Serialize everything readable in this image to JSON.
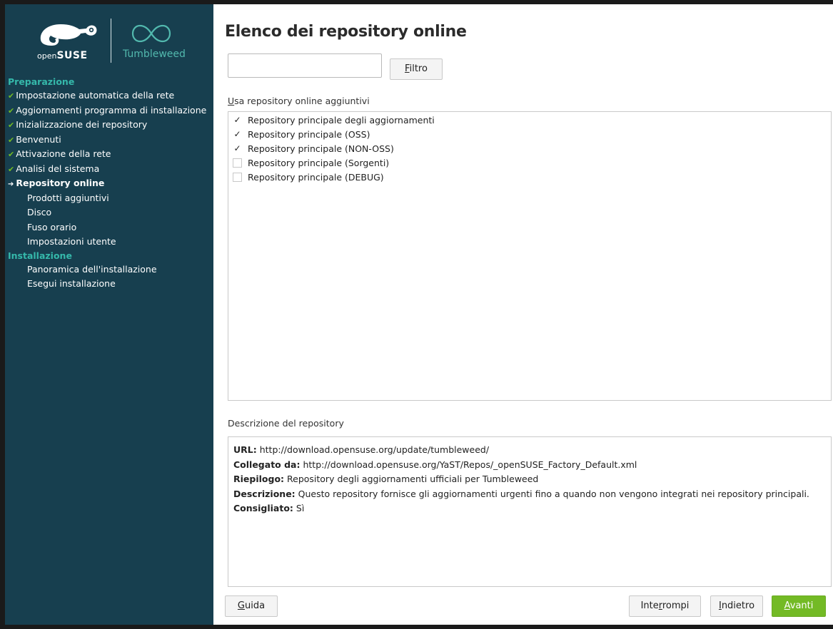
{
  "colors": {
    "sidebar_bg": "#173f4f",
    "accent_teal": "#35b9ab",
    "check_green": "#73ba25",
    "next_button_bg": "#73ba25"
  },
  "branding": {
    "gecko_icon": "opensuse-gecko-icon",
    "open_text": "open",
    "suse_text": "SUSE",
    "tumbleweed_icon": "tumbleweed-infinity-icon",
    "tumbleweed_text": "Tumbleweed"
  },
  "sidebar": {
    "sections": [
      {
        "heading": "Preparazione",
        "items": [
          {
            "label": "Impostazione automatica della rete",
            "state": "done"
          },
          {
            "label": "Aggiornamenti programma di installazione",
            "state": "done"
          },
          {
            "label": "Inizializzazione dei repository",
            "state": "done"
          },
          {
            "label": "Benvenuti",
            "state": "done"
          },
          {
            "label": "Attivazione della rete",
            "state": "done"
          },
          {
            "label": "Analisi del sistema",
            "state": "done"
          },
          {
            "label": "Repository online",
            "state": "current"
          },
          {
            "label": "Prodotti aggiuntivi",
            "state": "todo"
          },
          {
            "label": "Disco",
            "state": "todo"
          },
          {
            "label": "Fuso orario",
            "state": "todo"
          },
          {
            "label": "Impostazioni utente",
            "state": "todo"
          }
        ]
      },
      {
        "heading": "Installazione",
        "items": [
          {
            "label": "Panoramica dell'installazione",
            "state": "todo"
          },
          {
            "label": "Esegui installazione",
            "state": "todo"
          }
        ]
      }
    ]
  },
  "main": {
    "title": "Elenco dei repository online",
    "filter": {
      "value": "",
      "button_prefix": "",
      "button_mnemonic": "F",
      "button_rest": "iltro"
    },
    "repos_label_mnemonic": "U",
    "repos_label_rest": "sa repository online aggiuntivi",
    "repositories": [
      {
        "label": "Repository principale degli aggiornamenti",
        "checked": true
      },
      {
        "label": "Repository principale (OSS)",
        "checked": true
      },
      {
        "label": "Repository principale (NON-OSS)",
        "checked": true
      },
      {
        "label": "Repository principale (Sorgenti)",
        "checked": false
      },
      {
        "label": "Repository principale (DEBUG)",
        "checked": false
      }
    ],
    "description_label": "Descrizione del repository",
    "description": {
      "url_label": "URL:",
      "url_value": " http://download.opensuse.org/update/tumbleweed/",
      "linked_label": "Collegato da:",
      "linked_value": " http://download.opensuse.org/YaST/Repos/_openSUSE_Factory_Default.xml",
      "summary_label": "Riepilogo:",
      "summary_value": " Repository degli aggiornamenti ufficiali per Tumbleweed",
      "desc_label": "Descrizione:",
      "desc_value": " Questo repository fornisce gli aggiornamenti urgenti fino a quando non vengono integrati nei repository principali. ",
      "recommended_label": "Consigliato:",
      "recommended_value": " Sì"
    }
  },
  "footer": {
    "help": {
      "before": "",
      "mnemonic": "G",
      "after": "uida"
    },
    "abort": {
      "before": "Inte",
      "mnemonic": "r",
      "after": "rompi"
    },
    "back": {
      "before": "",
      "mnemonic": "I",
      "after": "ndietro"
    },
    "next": {
      "before": "",
      "mnemonic": "A",
      "after": "vanti"
    }
  }
}
